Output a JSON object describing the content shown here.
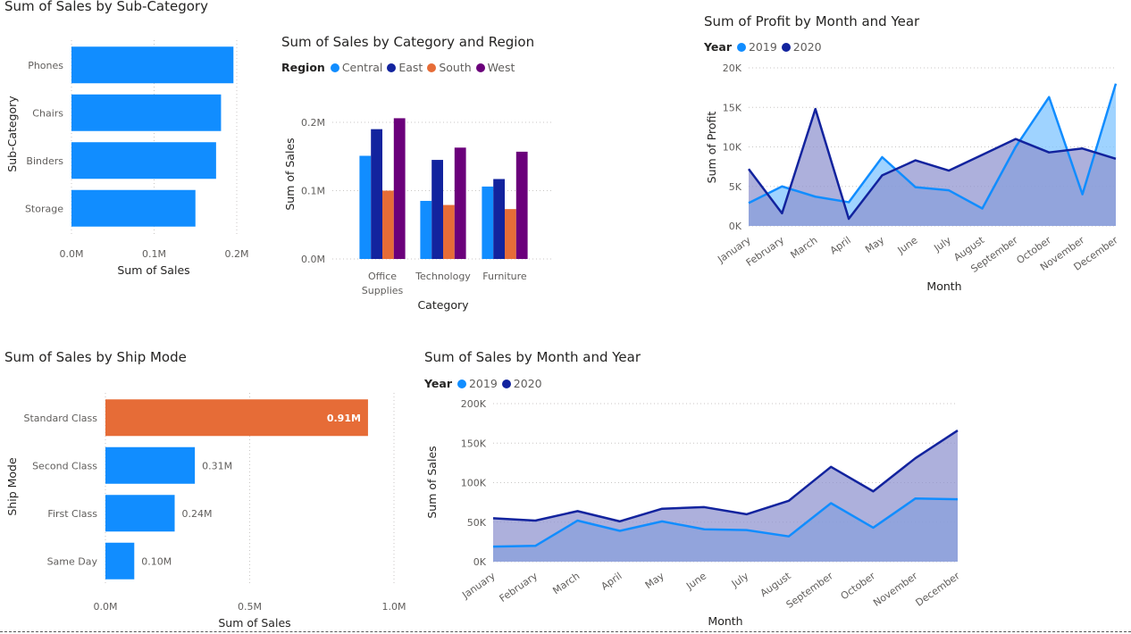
{
  "colors": {
    "blue": "#118DFF",
    "navy": "#12239E",
    "orange": "#E66C37",
    "purple": "#6B007B",
    "area2019": "#7FC4FF",
    "area2020": "#8E92CF",
    "overlap": "#6A86D8"
  },
  "charts": {
    "subcat": {
      "title": "Sum of Sales by Sub-Category",
      "xlabel": "Sum of Sales",
      "ylabel": "Sub-Category",
      "ticks": [
        "0.0M",
        "0.1M",
        "0.2M"
      ]
    },
    "catregion": {
      "title": "Sum of Sales by Category and Region",
      "legend_title": "Region",
      "xlabel": "Category",
      "ylabel": "Sum of Sales",
      "ticks": [
        "0.0M",
        "0.1M",
        "0.2M"
      ]
    },
    "profit": {
      "title": "Sum of Profit by Month and Year",
      "legend_title": "Year",
      "xlabel": "Month",
      "ylabel": "Sum of Profit",
      "ticks": [
        "0K",
        "5K",
        "10K",
        "15K",
        "20K"
      ]
    },
    "shipmode": {
      "title": "Sum of Sales by Ship Mode",
      "xlabel": "Sum of Sales",
      "ylabel": "Ship Mode",
      "ticks": [
        "0.0M",
        "0.5M",
        "1.0M"
      ]
    },
    "salesmonth": {
      "title": "Sum of Sales by Month and Year",
      "legend_title": "Year",
      "xlabel": "Month",
      "ylabel": "Sum of Sales",
      "ticks": [
        "0K",
        "50K",
        "100K",
        "150K",
        "200K"
      ]
    }
  },
  "chart_data": [
    {
      "type": "bar",
      "orientation": "horizontal",
      "title": "Sum of Sales by Sub-Category",
      "xlabel": "Sum of Sales",
      "ylabel": "Sub-Category",
      "categories": [
        "Phones",
        "Chairs",
        "Binders",
        "Storage"
      ],
      "values": [
        0.196,
        0.181,
        0.175,
        0.15
      ],
      "xlim": [
        0,
        0.2
      ],
      "unit": "M",
      "color": "#118DFF"
    },
    {
      "type": "bar",
      "orientation": "vertical",
      "title": "Sum of Sales by Category and Region",
      "xlabel": "Category",
      "ylabel": "Sum of Sales",
      "categories": [
        "Office Supplies",
        "Technology",
        "Furniture"
      ],
      "category_lines": [
        [
          "Office",
          "Supplies"
        ],
        [
          "Technology"
        ],
        [
          "Furniture"
        ]
      ],
      "series": [
        {
          "name": "Central",
          "color": "#118DFF",
          "values": [
            0.151,
            0.085,
            0.106
          ]
        },
        {
          "name": "East",
          "color": "#12239E",
          "values": [
            0.19,
            0.145,
            0.117
          ]
        },
        {
          "name": "South",
          "color": "#E66C37",
          "values": [
            0.1,
            0.079,
            0.073
          ]
        },
        {
          "name": "West",
          "color": "#6B007B",
          "values": [
            0.206,
            0.163,
            0.157
          ]
        }
      ],
      "ylim": [
        0,
        0.2
      ],
      "unit": "M"
    },
    {
      "type": "area",
      "title": "Sum of Profit by Month and Year",
      "xlabel": "Month",
      "ylabel": "Sum of Profit",
      "x": [
        "January",
        "February",
        "March",
        "April",
        "May",
        "June",
        "July",
        "August",
        "September",
        "October",
        "November",
        "December"
      ],
      "series": [
        {
          "name": "2019",
          "color": "#118DFF",
          "values": [
            2.9,
            5.0,
            3.7,
            3.0,
            8.7,
            4.9,
            4.5,
            2.2,
            10.0,
            16.3,
            4.0,
            18.0
          ]
        },
        {
          "name": "2020",
          "color": "#12239E",
          "values": [
            7.2,
            1.6,
            14.8,
            0.9,
            6.4,
            8.3,
            7.0,
            9.0,
            11.0,
            9.3,
            9.8,
            8.5
          ]
        }
      ],
      "ylim": [
        0,
        20
      ],
      "unit": "K"
    },
    {
      "type": "bar",
      "orientation": "horizontal",
      "title": "Sum of Sales by Ship Mode",
      "xlabel": "Sum of Sales",
      "ylabel": "Ship Mode",
      "categories": [
        "Standard Class",
        "Second Class",
        "First Class",
        "Same Day"
      ],
      "values": [
        0.91,
        0.31,
        0.24,
        0.1
      ],
      "labels": [
        "0.91M",
        "0.31M",
        "0.24M",
        "0.10M"
      ],
      "colors": [
        "#E66C37",
        "#118DFF",
        "#118DFF",
        "#118DFF"
      ],
      "xlim": [
        0,
        1.0
      ],
      "unit": "M"
    },
    {
      "type": "area",
      "title": "Sum of Sales by Month and Year",
      "xlabel": "Month",
      "ylabel": "Sum of Sales",
      "x": [
        "January",
        "February",
        "March",
        "April",
        "May",
        "June",
        "July",
        "August",
        "September",
        "October",
        "November",
        "December"
      ],
      "series": [
        {
          "name": "2019",
          "color": "#118DFF",
          "values": [
            19,
            20,
            52,
            39,
            51,
            41,
            40,
            32,
            74,
            43,
            80,
            79
          ]
        },
        {
          "name": "2020",
          "color": "#12239E",
          "values": [
            55,
            52,
            64,
            51,
            67,
            69,
            60,
            77,
            120,
            89,
            131,
            166
          ]
        }
      ],
      "ylim": [
        0,
        200
      ],
      "unit": "K"
    }
  ]
}
